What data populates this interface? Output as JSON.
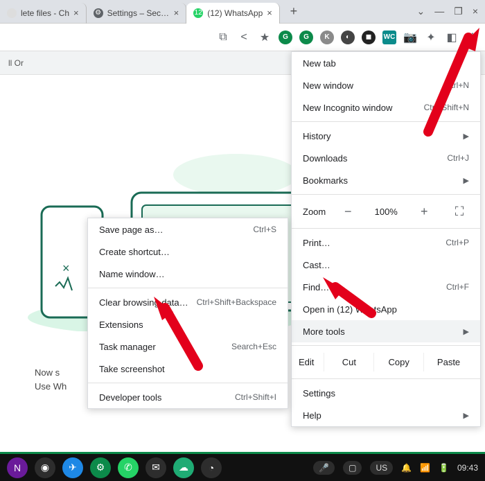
{
  "tabs": [
    {
      "label": "lete files - Ch",
      "favcolor": "#ddd"
    },
    {
      "label": "Settings – Security",
      "favcolor": "#5f6368"
    },
    {
      "label": "(12) WhatsApp",
      "favcolor": "#25d366",
      "favtext": "12",
      "active": true
    }
  ],
  "subbar": {
    "label": "ll Or"
  },
  "caption": {
    "line1": "Now s",
    "line2": "Use Wh"
  },
  "mainmenu": {
    "newtab": "New tab",
    "newwindow": "New window",
    "newwindow_sc": "Ctrl+N",
    "incognito": "New Incognito window",
    "incognito_sc": "Ctrl+Shift+N",
    "history": "History",
    "downloads": "Downloads",
    "downloads_sc": "Ctrl+J",
    "bookmarks": "Bookmarks",
    "zoom": "Zoom",
    "zoomval": "100%",
    "print": "Print…",
    "print_sc": "Ctrl+P",
    "cast": "Cast…",
    "find": "Find…",
    "find_sc": "Ctrl+F",
    "openin": "Open in (12) WhatsApp",
    "moretools": "More tools",
    "edit": "Edit",
    "cut": "Cut",
    "copy": "Copy",
    "paste": "Paste",
    "settings": "Settings",
    "help": "Help"
  },
  "submenu": {
    "savepage": "Save page as…",
    "savepage_sc": "Ctrl+S",
    "createshortcut": "Create shortcut…",
    "namewindow": "Name window…",
    "clearbrowsing": "Clear browsing data…",
    "clearbrowsing_sc": "Ctrl+Shift+Backspace",
    "extensions": "Extensions",
    "taskmanager": "Task manager",
    "taskmanager_sc": "Search+Esc",
    "screenshot": "Take screenshot",
    "devtools": "Developer tools",
    "devtools_sc": "Ctrl+Shift+I"
  },
  "taskbar": {
    "lang": "US",
    "time": "09:43"
  }
}
